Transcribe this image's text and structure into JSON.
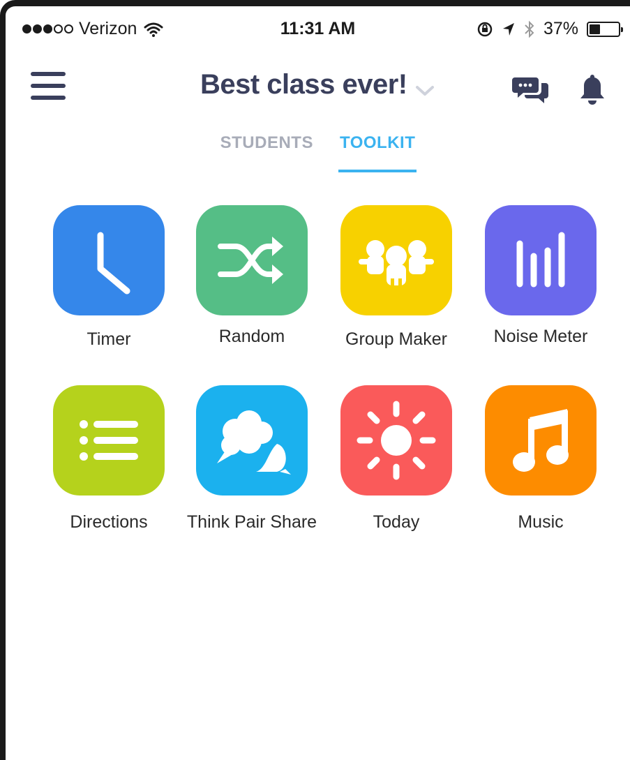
{
  "status_bar": {
    "carrier": "Verizon",
    "time": "11:31 AM",
    "battery_text": "37%",
    "battery_level": 0.37
  },
  "header": {
    "title": "Best class ever!",
    "icons": [
      "menu-icon",
      "chevron-down-icon",
      "chat-icon",
      "bell-icon"
    ]
  },
  "tabs": [
    {
      "label": "STUDENTS",
      "active": false
    },
    {
      "label": "TOOLKIT",
      "active": true
    }
  ],
  "tools": [
    {
      "label": "Timer",
      "icon": "clock-icon",
      "color": "#3587ea"
    },
    {
      "label": "Random",
      "icon": "shuffle-icon",
      "color": "#55be86"
    },
    {
      "label": "Group Maker",
      "icon": "group-icon",
      "color": "#f7d100"
    },
    {
      "label": "Noise Meter",
      "icon": "bars-icon",
      "color": "#6a68ec"
    },
    {
      "label": "Directions",
      "icon": "list-icon",
      "color": "#b5d21c"
    },
    {
      "label": "Think Pair Share",
      "icon": "speech-bubbles-icon",
      "color": "#1bb1ee"
    },
    {
      "label": "Today",
      "icon": "sun-icon",
      "color": "#fa5a5a"
    },
    {
      "label": "Music",
      "icon": "music-note-icon",
      "color": "#fd8c00"
    }
  ],
  "colors": {
    "title": "#3a3f5c",
    "tab_active": "#3bb3f0",
    "tab_inactive": "#a8acb8"
  }
}
